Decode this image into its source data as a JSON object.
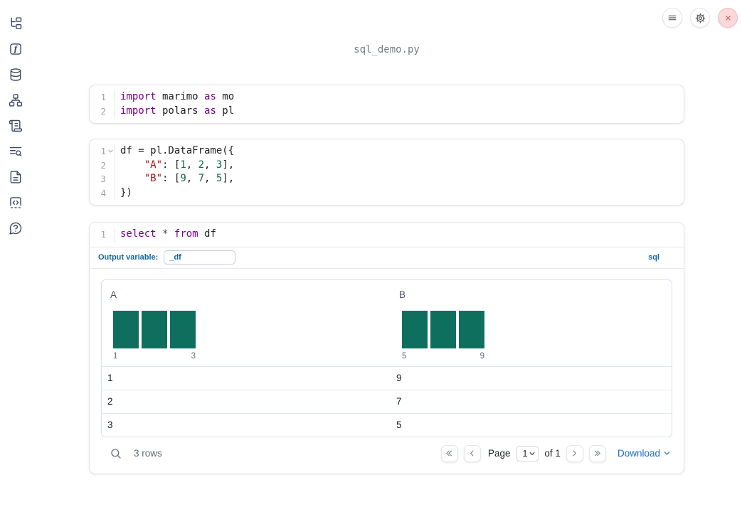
{
  "window": {
    "title": "sql_demo.py"
  },
  "topbar": {
    "buttons": [
      {
        "icon": "menu-icon"
      },
      {
        "icon": "settings-icon"
      },
      {
        "icon": "close-icon"
      }
    ]
  },
  "sidebar": {
    "items": [
      {
        "icon": "file-explorer-icon"
      },
      {
        "icon": "functions-icon"
      },
      {
        "icon": "data-sources-icon"
      },
      {
        "icon": "dependency-graph-icon"
      },
      {
        "icon": "scratchpad-icon"
      },
      {
        "icon": "logs-icon"
      },
      {
        "icon": "documentation-icon"
      },
      {
        "icon": "snippets-icon"
      },
      {
        "icon": "help-icon"
      }
    ]
  },
  "cells": [
    {
      "id": "imports",
      "lines": [
        {
          "n": "1",
          "tokens": [
            [
              "import",
              "kw"
            ],
            [
              " marimo ",
              "tx"
            ],
            [
              "as",
              "kw"
            ],
            [
              " mo",
              "tx"
            ]
          ]
        },
        {
          "n": "2",
          "tokens": [
            [
              "import",
              "kw"
            ],
            [
              " polars ",
              "tx"
            ],
            [
              "as",
              "kw"
            ],
            [
              " pl",
              "tx"
            ]
          ]
        }
      ]
    },
    {
      "id": "dataframe",
      "lines": [
        {
          "n": "1",
          "fold": true,
          "tokens": [
            [
              "df = pl.DataFrame({",
              "tx"
            ]
          ]
        },
        {
          "n": "2",
          "tokens": [
            [
              "    ",
              "tx"
            ],
            [
              "\"A\"",
              "str"
            ],
            [
              ": [",
              "tx"
            ],
            [
              "1",
              "num"
            ],
            [
              ", ",
              "tx"
            ],
            [
              "2",
              "num"
            ],
            [
              ", ",
              "tx"
            ],
            [
              "3",
              "num"
            ],
            [
              "],",
              "tx"
            ]
          ]
        },
        {
          "n": "3",
          "tokens": [
            [
              "    ",
              "tx"
            ],
            [
              "\"B\"",
              "str"
            ],
            [
              ": [",
              "tx"
            ],
            [
              "9",
              "num"
            ],
            [
              ", ",
              "tx"
            ],
            [
              "7",
              "num"
            ],
            [
              ", ",
              "tx"
            ],
            [
              "5",
              "num"
            ],
            [
              "],",
              "tx"
            ]
          ]
        },
        {
          "n": "4",
          "tokens": [
            [
              "})",
              "tx"
            ]
          ]
        }
      ]
    },
    {
      "id": "sql",
      "lines": [
        {
          "n": "1",
          "tokens": [
            [
              "select",
              "kw"
            ],
            [
              " ",
              "tx"
            ],
            [
              "*",
              "op"
            ],
            [
              " ",
              "tx"
            ],
            [
              "from",
              "kw"
            ],
            [
              " df",
              "tx"
            ]
          ]
        }
      ],
      "output_variable_label": "Output variable:",
      "output_variable_value": "_df",
      "language_badge": "sql"
    }
  ],
  "table": {
    "columns": [
      {
        "name": "A",
        "histogram": {
          "bar_count": 3,
          "min_label": "1",
          "max_label": "3"
        }
      },
      {
        "name": "B",
        "histogram": {
          "bar_count": 3,
          "min_label": "5",
          "max_label": "9"
        }
      }
    ],
    "rows": [
      [
        "1",
        "9"
      ],
      [
        "2",
        "7"
      ],
      [
        "3",
        "5"
      ]
    ],
    "footer": {
      "row_count": "3 rows",
      "page_label": "Page",
      "page_value": "1",
      "of_label": "of 1",
      "download_label": "Download"
    }
  },
  "colors": {
    "accent_blue": "#11659c",
    "histogram_green": "#0e6f5f",
    "download_blue": "#1a6bcc",
    "close_red": "#d95757",
    "keyword_purple": "#770088",
    "string_red": "#aa1111",
    "number_green": "#116644"
  }
}
